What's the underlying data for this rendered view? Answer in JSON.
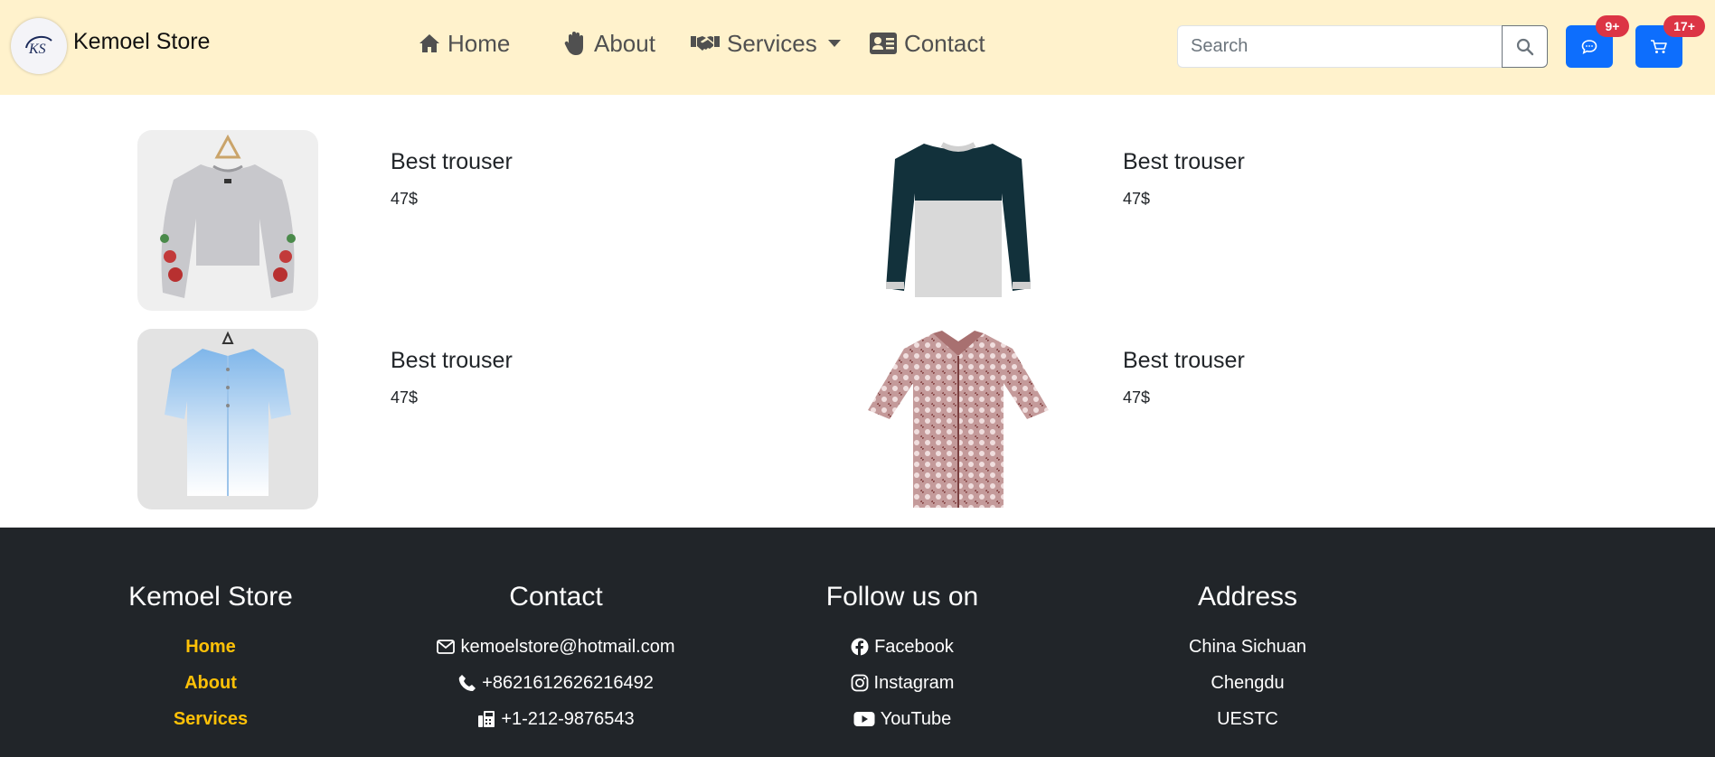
{
  "brand": {
    "name": "Kemoel Store",
    "logo_text": "KS"
  },
  "nav": {
    "home": "Home",
    "about": "About",
    "services": "Services",
    "contact": "Contact"
  },
  "search": {
    "placeholder": "Search",
    "value": ""
  },
  "badges": {
    "messages": "9+",
    "cart": "17+"
  },
  "products": [
    {
      "title": "Best trouser",
      "price": "47$"
    },
    {
      "title": "Best trouser",
      "price": "47$"
    },
    {
      "title": "Best trouser",
      "price": "47$"
    },
    {
      "title": "Best trouser",
      "price": "47$"
    }
  ],
  "footer": {
    "brand": {
      "title": "Kemoel Store",
      "links": [
        "Home",
        "About",
        "Services"
      ]
    },
    "contact": {
      "title": "Contact",
      "email": "kemoelstore@hotmail.com",
      "phone": "+8621612626216492",
      "fax": "+1-212-9876543"
    },
    "follow": {
      "title": "Follow us on",
      "links": [
        "Facebook",
        "Instagram",
        "YouTube"
      ]
    },
    "address": {
      "title": "Address",
      "lines": [
        "China Sichuan",
        "Chengdu",
        "UESTC"
      ]
    }
  },
  "colors": {
    "navbar_bg": "#fff2cc",
    "primary": "#0d6efd",
    "badge": "#dc3545",
    "footer_bg": "#212529",
    "footer_link": "#ffc107"
  }
}
